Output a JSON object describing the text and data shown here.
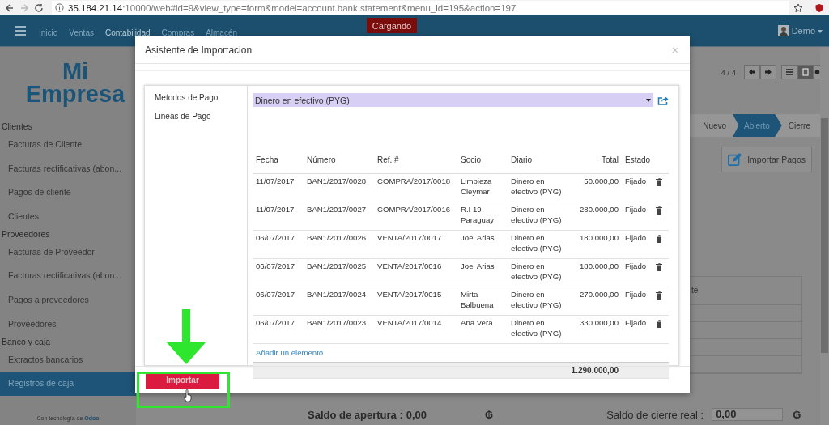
{
  "browser": {
    "url_host": "35.184.21.14",
    "url_path": ":10000/web#id=9&view_type=form&model=account.bank.statement&menu_id=195&action=197"
  },
  "navbar": {
    "menus": [
      {
        "label": "Inicio",
        "selected": false
      },
      {
        "label": "Ventas",
        "selected": false
      },
      {
        "label": "Contabilidad",
        "selected": true
      },
      {
        "label": "Compras",
        "selected": false
      },
      {
        "label": "Almacén",
        "selected": false
      }
    ],
    "loading_badge": "Cargando",
    "user": "Demo"
  },
  "sidebar": {
    "logo_lines": [
      "Mi",
      "Empresa"
    ],
    "sections": [
      {
        "title": "Clientes",
        "items": [
          {
            "label": "Facturas de Cliente",
            "selected": false
          },
          {
            "label": "Facturas rectificativas (abon...",
            "selected": false
          },
          {
            "label": "Pagos de cliente",
            "selected": false
          },
          {
            "label": "Clientes",
            "selected": false
          }
        ]
      },
      {
        "title": "Proveedores",
        "items": [
          {
            "label": "Facturas de Proveedor",
            "selected": false
          },
          {
            "label": "Facturas rectificativas (abon...",
            "selected": false
          },
          {
            "label": "Pagos a proveedores",
            "selected": false
          },
          {
            "label": "Proveedores",
            "selected": false
          }
        ]
      },
      {
        "title": "Banco y caja",
        "items": [
          {
            "label": "Extractos bancarios",
            "selected": false
          },
          {
            "label": "Registros de caja",
            "selected": true
          }
        ]
      }
    ],
    "footer_text": "Con tecnología de",
    "footer_link": "Odoo"
  },
  "record": {
    "pager": "4 / 4",
    "stages": [
      {
        "label": "Nuevo",
        "selected": false
      },
      {
        "label": "Abierto",
        "selected": true
      },
      {
        "label": "Cierre",
        "selected": false
      }
    ],
    "import_button": "Importar Pagos",
    "lines_header": "te",
    "opening_label": "Saldo de apertura :",
    "opening_value": "0,00",
    "closing_label": "Saldo de cierre real :",
    "closing_value": "0,00",
    "currency": "₲"
  },
  "dialog": {
    "title": "Asistente de Importacion",
    "close": "×",
    "field_labels": [
      "Metodos de Pago",
      "Lineas de Pago"
    ],
    "payment_method": "Dinero en efectivo (PYG)",
    "columns": [
      "Fecha",
      "Número",
      "Ref. #",
      "Socio",
      "Diario",
      "Total",
      "Estado"
    ],
    "rows": [
      [
        "11/07/2017",
        "BAN1/2017/0028",
        "COMPRA/2017/0018",
        "Limpieza Cleymar",
        "Dinero en efectivo (PYG)",
        "50.000,00",
        "Fijado"
      ],
      [
        "11/07/2017",
        "BAN1/2017/0027",
        "COMPRA/2017/0016",
        "R.I 19 Paraguay",
        "Dinero en efectivo (PYG)",
        "280.000,00",
        "Fijado"
      ],
      [
        "06/07/2017",
        "BAN1/2017/0026",
        "VENTA/2017/0017",
        "Joel Arias",
        "Dinero en efectivo (PYG)",
        "180.000,00",
        "Fijado"
      ],
      [
        "06/07/2017",
        "BAN1/2017/0025",
        "VENTA/2017/0016",
        "Joel Arias",
        "Dinero en efectivo (PYG)",
        "180.000,00",
        "Fijado"
      ],
      [
        "06/07/2017",
        "BAN1/2017/0024",
        "VENTA/2017/0015",
        "Mirta Balbuena",
        "Dinero en efectivo (PYG)",
        "270.000,00",
        "Fijado"
      ],
      [
        "06/07/2017",
        "BAN1/2017/0023",
        "VENTA/2017/0014",
        "Ana Vera",
        "Dinero en efectivo (PYG)",
        "330.000,00",
        "Fijado"
      ]
    ],
    "add_line": "Añadir un elemento",
    "total": "1.290.000,00",
    "import_button": "Importar"
  }
}
